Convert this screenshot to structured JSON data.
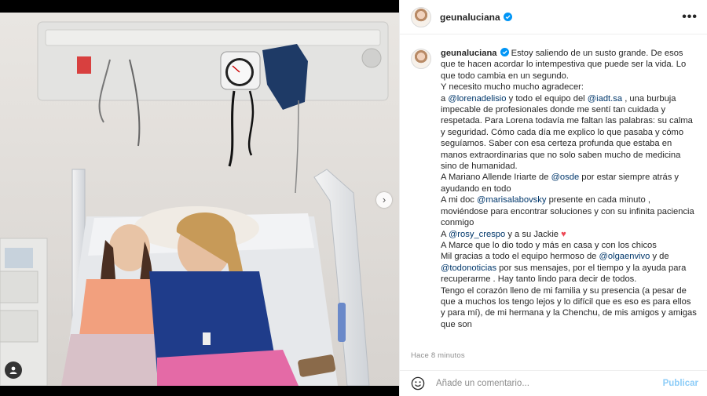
{
  "post": {
    "username": "geunaluciana",
    "caption_lines": [
      "Estoy saliendo de un susto grande. De esos que te",
      "hacen acordar lo intempestiva que puede ser la vida. Lo que todo",
      "cambia en un segundo.",
      "Y necesito mucho mucho agradecer:",
      "a ",
      "@lorenadelisio",
      " y todo el equipo del ",
      "@iadt.sa",
      " , una burbuja",
      "impecable de profesionales donde me sentí tan cuidada y",
      "respetada. Para Lorena todavía me faltan las palabras: su calma y",
      "seguridad. Cómo cada día me explico lo que pasaba y cómo",
      "seguíamos. Saber con esa certeza profunda que estaba en manos",
      "extraordinarias que no solo saben mucho de medicina sino de",
      "humanidad.",
      "A Mariano Allende Iriarte de ",
      "@osde",
      " por estar siempre atrás y",
      "ayudando en todo",
      "A mi doc ",
      "@marisalabovsky",
      " presente en cada minuto , moviéndose",
      "para encontrar soluciones y con su infinita paciencia conmigo",
      "A ",
      "@rosy_crespo",
      " y a su Jackie ",
      "A Marce que lo dio todo y más en casa y con los chicos",
      "Mil gracias a todo el equipo hermoso de ",
      "@olgaenvivo",
      " y de",
      "@todonoticias",
      " por sus mensajes, por el tiempo y la ayuda para",
      "recuperarme . Hay tanto lindo para decir de todos.",
      "Tengo el corazón lleno de mi familia y su presencia (a pesar de que",
      "a muchos los tengo lejos y lo difícil que es eso es para ellos y para",
      "mí), de mi hermana y la Chenchu, de mis amigos y amigas que son"
    ],
    "heart_glyph": "♥",
    "timestamp": "Hace 8 minutos",
    "comment_placeholder": "Añade un comentario...",
    "publish_label": "Publicar",
    "more_glyph": "•••",
    "carousel_next_glyph": "›"
  },
  "colors": {
    "mention": "#00376b",
    "publish": "#8ecdf8",
    "verified": "#0095f6",
    "heart": "#ed4956"
  },
  "icons": [
    "verified-badge-icon",
    "more-options-icon",
    "chevron-right-icon",
    "user-tag-icon",
    "emoji-smiley-icon",
    "heart-icon"
  ]
}
